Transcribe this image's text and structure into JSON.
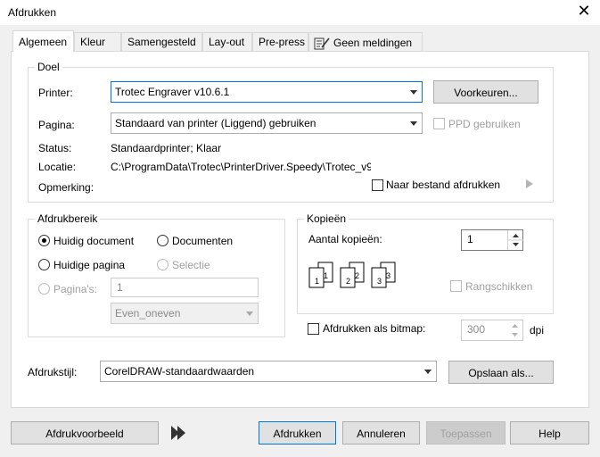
{
  "window": {
    "title": "Afdrukken"
  },
  "tabs": [
    {
      "label": "Algemeen"
    },
    {
      "label": "Kleur"
    },
    {
      "label": "Samengesteld"
    },
    {
      "label": "Lay-out"
    },
    {
      "label": "Pre-press"
    },
    {
      "label": "Geen meldingen"
    }
  ],
  "doel": {
    "legend": "Doel",
    "printer_label": "Printer:",
    "printer_value": "Trotec Engraver v10.6.1",
    "preferences_button": "Voorkeuren...",
    "pagina_label": "Pagina:",
    "pagina_value": "Standaard van printer (Liggend) gebruiken",
    "ppd_label": "PPD gebruiken",
    "status_label": "Status:",
    "status_value": "Standaardprinter; Klaar",
    "locatie_label": "Locatie:",
    "locatie_value": "C:\\ProgramData\\Trotec\\PrinterDriver.Speedy\\Trotec_v9",
    "opmerking_label": "Opmerking:",
    "naar_bestand_label": "Naar bestand afdrukken"
  },
  "afdrukbereik": {
    "legend": "Afdrukbereik",
    "huidig_document": "Huidig document",
    "documenten": "Documenten",
    "huidige_pagina": "Huidige pagina",
    "selectie": "Selectie",
    "paginas_label": "Pagina's:",
    "paginas_value": "1",
    "even_oneven": "Even_oneven"
  },
  "kopieen": {
    "legend": "Kopieën",
    "aantal_label": "Aantal kopieën:",
    "aantal_value": "1",
    "rangschikken": "Rangschikken"
  },
  "bitmap": {
    "label": "Afdrukken als bitmap:",
    "dpi_value": "300",
    "dpi_unit": "dpi"
  },
  "afdrukstijl": {
    "label": "Afdrukstijl:",
    "value": "CorelDRAW-standaardwaarden",
    "opslaan_button": "Opslaan als..."
  },
  "footer": {
    "preview_button": "Afdrukvoorbeeld",
    "print_button": "Afdrukken",
    "cancel_button": "Annuleren",
    "apply_button": "Toepassen",
    "help_button": "Help"
  }
}
